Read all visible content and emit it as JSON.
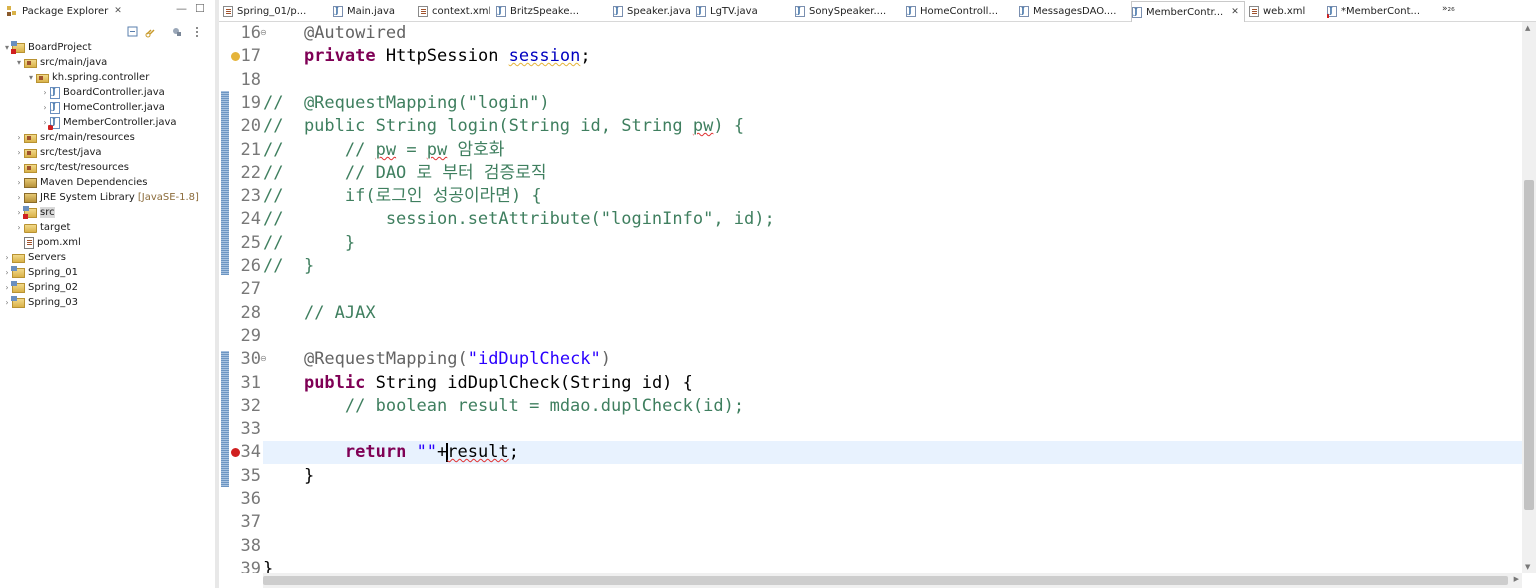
{
  "explorer": {
    "title": "Package Explorer",
    "close": "✕",
    "minimize": "—",
    "maximize": "☐",
    "items": [
      {
        "label": "BoardProject",
        "icon": "project-error-icon",
        "expanded": true
      },
      {
        "label": "src/main/java",
        "icon": "source-folder-icon",
        "expanded": true
      },
      {
        "label": "kh.spring.controller",
        "icon": "package-icon",
        "expanded": true
      },
      {
        "label": "BoardController.java",
        "icon": "java-file-icon"
      },
      {
        "label": "HomeController.java",
        "icon": "java-file-icon"
      },
      {
        "label": "MemberController.java",
        "icon": "java-file-error-icon"
      },
      {
        "label": "src/main/resources",
        "icon": "source-folder-icon"
      },
      {
        "label": "src/test/java",
        "icon": "source-folder-icon"
      },
      {
        "label": "src/test/resources",
        "icon": "source-folder-icon"
      },
      {
        "label": "Maven Dependencies",
        "icon": "library-icon"
      },
      {
        "label": "JRE System Library",
        "decoration": "[JavaSE-1.8]",
        "icon": "library-icon"
      },
      {
        "label": "src",
        "icon": "folder-error-icon",
        "selected": true
      },
      {
        "label": "target",
        "icon": "folder-icon"
      },
      {
        "label": "pom.xml",
        "icon": "xml-file-icon"
      },
      {
        "label": "Servers",
        "icon": "server-folder-icon"
      },
      {
        "label": "Spring_01",
        "icon": "project-icon"
      },
      {
        "label": "Spring_02",
        "icon": "project-icon"
      },
      {
        "label": "Spring_03",
        "icon": "project-icon"
      }
    ]
  },
  "tabs": [
    {
      "label": "Spring_01/p...",
      "icon": "xml-file-icon"
    },
    {
      "label": "Main.java",
      "icon": "java-file-icon"
    },
    {
      "label": "context.xml",
      "icon": "xml-file-icon"
    },
    {
      "label": "BritzSpeake...",
      "icon": "java-file-icon"
    },
    {
      "label": "Speaker.java",
      "icon": "java-file-icon"
    },
    {
      "label": "LgTV.java",
      "icon": "java-file-icon"
    },
    {
      "label": "SonySpeaker....",
      "icon": "java-file-icon"
    },
    {
      "label": "HomeControll...",
      "icon": "java-file-icon"
    },
    {
      "label": "MessagesDAO....",
      "icon": "java-file-icon"
    },
    {
      "label": "MemberContr...",
      "icon": "java-file-icon",
      "active": true,
      "close": "✕"
    },
    {
      "label": "web.xml",
      "icon": "xml-file-icon"
    },
    {
      "label": "*MemberCont...",
      "icon": "java-file-error-icon"
    }
  ],
  "overflow_tabs": "»₂₆",
  "editor": {
    "lines": [
      {
        "num": "16",
        "fold": "⊖",
        "segments": [
          {
            "t": "    ",
            "c": "c-plain"
          },
          {
            "t": "@Autowired",
            "c": "c-ann"
          }
        ]
      },
      {
        "num": "17",
        "marker": "warn",
        "segments": [
          {
            "t": "    ",
            "c": "c-plain"
          },
          {
            "t": "private",
            "c": "c-kw"
          },
          {
            "t": " HttpSession ",
            "c": "c-plain"
          },
          {
            "t": "session",
            "c": "c-fld c-sq"
          },
          {
            "t": ";",
            "c": "c-plain"
          }
        ]
      },
      {
        "num": "18",
        "segments": []
      },
      {
        "num": "19",
        "segments": [
          {
            "t": "//  @RequestMapping(\"login\")",
            "c": "c-com"
          }
        ]
      },
      {
        "num": "20",
        "segments": [
          {
            "t": "//  public String login(String id, String ",
            "c": "c-com"
          },
          {
            "t": "pw",
            "c": "c-com c-sqr"
          },
          {
            "t": ") {",
            "c": "c-com"
          }
        ]
      },
      {
        "num": "21",
        "segments": [
          {
            "t": "//      // ",
            "c": "c-com"
          },
          {
            "t": "pw",
            "c": "c-com c-sqr"
          },
          {
            "t": " = ",
            "c": "c-com"
          },
          {
            "t": "pw",
            "c": "c-com c-sqr"
          },
          {
            "t": " 암호화",
            "c": "c-com"
          }
        ]
      },
      {
        "num": "22",
        "segments": [
          {
            "t": "//      // DAO 로 부터 검증로직",
            "c": "c-com"
          }
        ]
      },
      {
        "num": "23",
        "segments": [
          {
            "t": "//      if(로그인 성공이라면) {",
            "c": "c-com"
          }
        ]
      },
      {
        "num": "24",
        "segments": [
          {
            "t": "//          session.setAttribute(\"loginInfo\", id);",
            "c": "c-com"
          }
        ]
      },
      {
        "num": "25",
        "segments": [
          {
            "t": "//      }",
            "c": "c-com"
          }
        ]
      },
      {
        "num": "26",
        "segments": [
          {
            "t": "//  }",
            "c": "c-com"
          }
        ]
      },
      {
        "num": "27",
        "segments": []
      },
      {
        "num": "28",
        "segments": [
          {
            "t": "    ",
            "c": "c-plain"
          },
          {
            "t": "// AJAX",
            "c": "c-com"
          }
        ]
      },
      {
        "num": "29",
        "segments": []
      },
      {
        "num": "30",
        "fold": "⊖",
        "segments": [
          {
            "t": "    ",
            "c": "c-plain"
          },
          {
            "t": "@RequestMapping(",
            "c": "c-ann"
          },
          {
            "t": "\"idDuplCheck\"",
            "c": "c-str"
          },
          {
            "t": ")",
            "c": "c-ann"
          }
        ]
      },
      {
        "num": "31",
        "segments": [
          {
            "t": "    ",
            "c": "c-plain"
          },
          {
            "t": "public",
            "c": "c-kw"
          },
          {
            "t": " String idDuplCheck(String id) {",
            "c": "c-plain"
          }
        ]
      },
      {
        "num": "32",
        "segments": [
          {
            "t": "        ",
            "c": "c-plain"
          },
          {
            "t": "// boolean result = mdao.duplCheck(id);",
            "c": "c-com"
          }
        ]
      },
      {
        "num": "33",
        "segments": []
      },
      {
        "num": "34",
        "marker": "err",
        "current": true,
        "segments": [
          {
            "t": "        ",
            "c": "c-plain"
          },
          {
            "t": "return",
            "c": "c-kw"
          },
          {
            "t": " ",
            "c": "c-plain"
          },
          {
            "t": "\"\"",
            "c": "c-str"
          },
          {
            "t": "+",
            "c": "c-plain"
          },
          {
            "t": "CARET",
            "c": "caret"
          },
          {
            "t": "result",
            "c": "c-plain c-sqr"
          },
          {
            "t": ";",
            "c": "c-plain"
          }
        ]
      },
      {
        "num": "35",
        "segments": [
          {
            "t": "    }",
            "c": "c-plain"
          }
        ]
      },
      {
        "num": "36",
        "segments": []
      },
      {
        "num": "37",
        "segments": []
      },
      {
        "num": "38",
        "segments": []
      },
      {
        "num": "39",
        "segments": [
          {
            "t": "}",
            "c": "c-plain"
          }
        ]
      }
    ]
  },
  "colors": {
    "keyword": "#7f0055",
    "comment": "#3f7f5f",
    "string": "#2a00ff",
    "annotation": "#646464",
    "field": "#0000c0",
    "current_line": "#e8f2fe"
  }
}
